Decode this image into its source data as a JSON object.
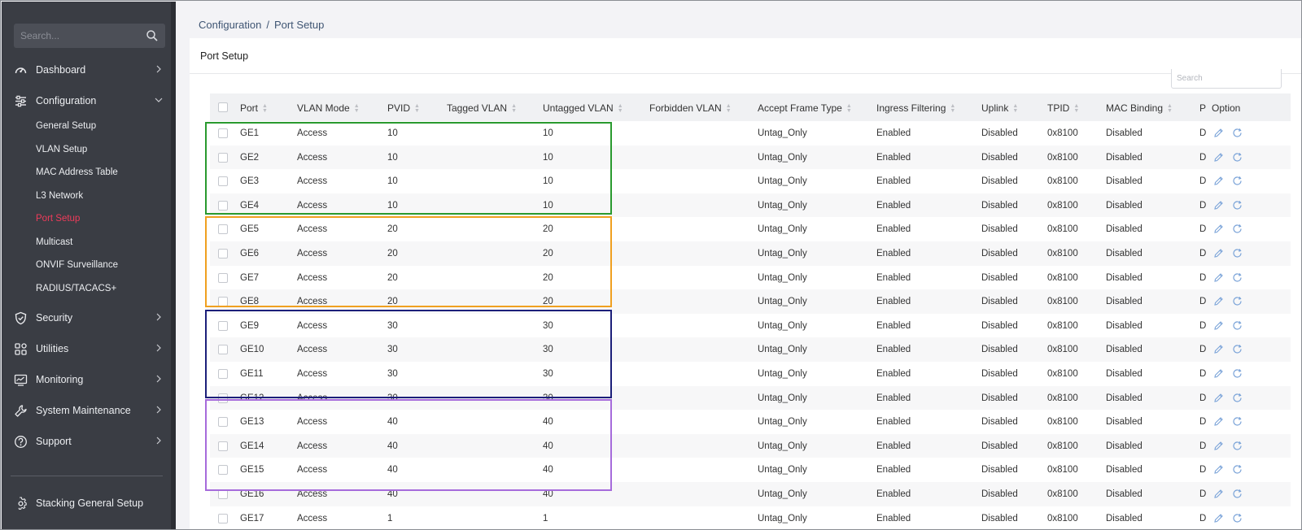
{
  "sidebar": {
    "search_placeholder": "Search...",
    "nav": [
      {
        "label": "Dashboard",
        "icon": "gauge-icon"
      },
      {
        "label": "Configuration",
        "icon": "sliders-icon"
      },
      {
        "label": "Security",
        "icon": "shield-check-icon"
      },
      {
        "label": "Utilities",
        "icon": "grid-icon"
      },
      {
        "label": "Monitoring",
        "icon": "monitor-chart-icon"
      },
      {
        "label": "System Maintenance",
        "icon": "wrench-icon"
      },
      {
        "label": "Support",
        "icon": "help-circle-icon"
      },
      {
        "label": "Stacking General Setup",
        "icon": "gear-icon"
      }
    ],
    "config_sub": [
      "General Setup",
      "VLAN Setup",
      "MAC Address Table",
      "L3 Network",
      "Port Setup",
      "Multicast",
      "ONVIF Surveillance",
      "RADIUS/TACACS+"
    ],
    "active_sub": "Port Setup",
    "active_color": "#ee3b5a"
  },
  "breadcrumb": {
    "parent": "Configuration",
    "separator": "/",
    "current": "Port Setup"
  },
  "card": {
    "title": "Port Setup",
    "search_placeholder": "Search"
  },
  "table": {
    "columns": [
      "Port",
      "VLAN Mode",
      "PVID",
      "Tagged VLAN",
      "Untagged VLAN",
      "Forbidden VLAN",
      "Accept Frame Type",
      "Ingress Filtering",
      "Uplink",
      "TPID",
      "MAC Binding",
      "P",
      "Option"
    ],
    "rows": [
      {
        "port": "GE1",
        "mode": "Access",
        "pvid": "10",
        "tagged": "",
        "untagged": "10",
        "forbidden": "",
        "frame": "Untag_Only",
        "ingress": "Enabled",
        "uplink": "Disabled",
        "tpid": "0x8100",
        "mac": "Disabled",
        "p": "Di"
      },
      {
        "port": "GE2",
        "mode": "Access",
        "pvid": "10",
        "tagged": "",
        "untagged": "10",
        "forbidden": "",
        "frame": "Untag_Only",
        "ingress": "Enabled",
        "uplink": "Disabled",
        "tpid": "0x8100",
        "mac": "Disabled",
        "p": "Di"
      },
      {
        "port": "GE3",
        "mode": "Access",
        "pvid": "10",
        "tagged": "",
        "untagged": "10",
        "forbidden": "",
        "frame": "Untag_Only",
        "ingress": "Enabled",
        "uplink": "Disabled",
        "tpid": "0x8100",
        "mac": "Disabled",
        "p": "Di"
      },
      {
        "port": "GE4",
        "mode": "Access",
        "pvid": "10",
        "tagged": "",
        "untagged": "10",
        "forbidden": "",
        "frame": "Untag_Only",
        "ingress": "Enabled",
        "uplink": "Disabled",
        "tpid": "0x8100",
        "mac": "Disabled",
        "p": "Di"
      },
      {
        "port": "GE5",
        "mode": "Access",
        "pvid": "20",
        "tagged": "",
        "untagged": "20",
        "forbidden": "",
        "frame": "Untag_Only",
        "ingress": "Enabled",
        "uplink": "Disabled",
        "tpid": "0x8100",
        "mac": "Disabled",
        "p": "Di"
      },
      {
        "port": "GE6",
        "mode": "Access",
        "pvid": "20",
        "tagged": "",
        "untagged": "20",
        "forbidden": "",
        "frame": "Untag_Only",
        "ingress": "Enabled",
        "uplink": "Disabled",
        "tpid": "0x8100",
        "mac": "Disabled",
        "p": "Di"
      },
      {
        "port": "GE7",
        "mode": "Access",
        "pvid": "20",
        "tagged": "",
        "untagged": "20",
        "forbidden": "",
        "frame": "Untag_Only",
        "ingress": "Enabled",
        "uplink": "Disabled",
        "tpid": "0x8100",
        "mac": "Disabled",
        "p": "Di"
      },
      {
        "port": "GE8",
        "mode": "Access",
        "pvid": "20",
        "tagged": "",
        "untagged": "20",
        "forbidden": "",
        "frame": "Untag_Only",
        "ingress": "Enabled",
        "uplink": "Disabled",
        "tpid": "0x8100",
        "mac": "Disabled",
        "p": "Di"
      },
      {
        "port": "GE9",
        "mode": "Access",
        "pvid": "30",
        "tagged": "",
        "untagged": "30",
        "forbidden": "",
        "frame": "Untag_Only",
        "ingress": "Enabled",
        "uplink": "Disabled",
        "tpid": "0x8100",
        "mac": "Disabled",
        "p": "Di"
      },
      {
        "port": "GE10",
        "mode": "Access",
        "pvid": "30",
        "tagged": "",
        "untagged": "30",
        "forbidden": "",
        "frame": "Untag_Only",
        "ingress": "Enabled",
        "uplink": "Disabled",
        "tpid": "0x8100",
        "mac": "Disabled",
        "p": "Di"
      },
      {
        "port": "GE11",
        "mode": "Access",
        "pvid": "30",
        "tagged": "",
        "untagged": "30",
        "forbidden": "",
        "frame": "Untag_Only",
        "ingress": "Enabled",
        "uplink": "Disabled",
        "tpid": "0x8100",
        "mac": "Disabled",
        "p": "Di"
      },
      {
        "port": "GE12",
        "mode": "Access",
        "pvid": "30",
        "tagged": "",
        "untagged": "30",
        "forbidden": "",
        "frame": "Untag_Only",
        "ingress": "Enabled",
        "uplink": "Disabled",
        "tpid": "0x8100",
        "mac": "Disabled",
        "p": "Di"
      },
      {
        "port": "GE13",
        "mode": "Access",
        "pvid": "40",
        "tagged": "",
        "untagged": "40",
        "forbidden": "",
        "frame": "Untag_Only",
        "ingress": "Enabled",
        "uplink": "Disabled",
        "tpid": "0x8100",
        "mac": "Disabled",
        "p": "Di"
      },
      {
        "port": "GE14",
        "mode": "Access",
        "pvid": "40",
        "tagged": "",
        "untagged": "40",
        "forbidden": "",
        "frame": "Untag_Only",
        "ingress": "Enabled",
        "uplink": "Disabled",
        "tpid": "0x8100",
        "mac": "Disabled",
        "p": "Di"
      },
      {
        "port": "GE15",
        "mode": "Access",
        "pvid": "40",
        "tagged": "",
        "untagged": "40",
        "forbidden": "",
        "frame": "Untag_Only",
        "ingress": "Enabled",
        "uplink": "Disabled",
        "tpid": "0x8100",
        "mac": "Disabled",
        "p": "Di"
      },
      {
        "port": "GE16",
        "mode": "Access",
        "pvid": "40",
        "tagged": "",
        "untagged": "40",
        "forbidden": "",
        "frame": "Untag_Only",
        "ingress": "Enabled",
        "uplink": "Disabled",
        "tpid": "0x8100",
        "mac": "Disabled",
        "p": "Di"
      },
      {
        "port": "GE17",
        "mode": "Access",
        "pvid": "1",
        "tagged": "",
        "untagged": "1",
        "forbidden": "",
        "frame": "Untag_Only",
        "ingress": "Enabled",
        "uplink": "Disabled",
        "tpid": "0x8100",
        "mac": "Disabled",
        "p": "Di"
      }
    ],
    "row_actions": [
      "edit-icon",
      "refresh-icon"
    ],
    "action_color": "#7aa3d8"
  },
  "annotations": [
    {
      "group": "VLAN 10",
      "ports": "GE1-GE4",
      "color": "#2a9a2f"
    },
    {
      "group": "VLAN 20",
      "ports": "GE5-GE8",
      "color": "#f0a020"
    },
    {
      "group": "VLAN 30",
      "ports": "GE9-GE12",
      "color": "#1c1f7a"
    },
    {
      "group": "VLAN 40",
      "ports": "GE13-GE16",
      "color": "#a66bdb"
    }
  ]
}
